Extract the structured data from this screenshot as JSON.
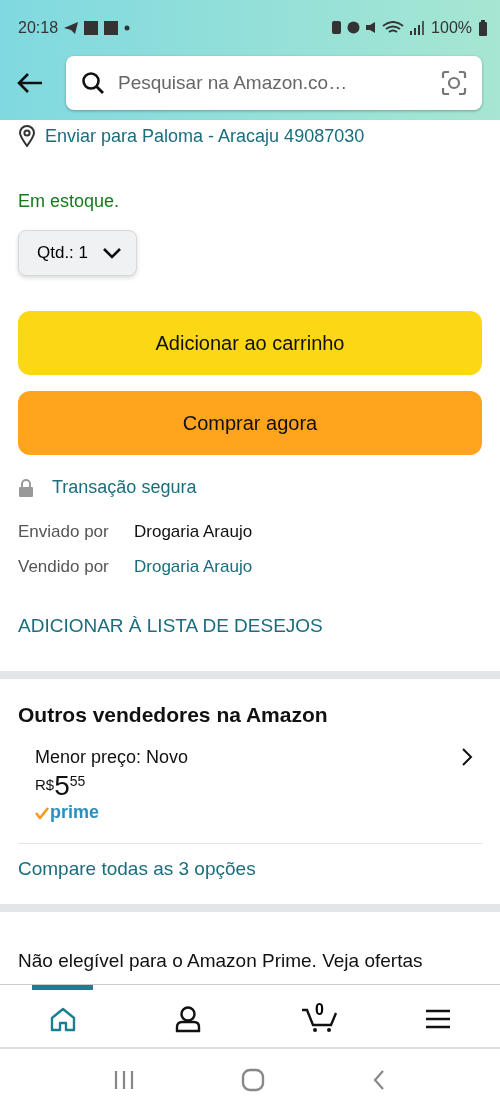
{
  "status_bar": {
    "time": "20:18",
    "battery": "100%"
  },
  "search": {
    "placeholder": "Pesquisar na Amazon.co…"
  },
  "delivery": {
    "text": "Enviar para Paloma - Aracaju 49087030"
  },
  "stock": "Em estoque.",
  "quantity": {
    "label": "Qtd.:",
    "value": "1"
  },
  "buttons": [
    {
      "label": "Adicionar ao carrinho",
      "kind": "cart"
    },
    {
      "label": "Comprar agora",
      "kind": "buy"
    }
  ],
  "secure": "Transação segura",
  "seller_info": [
    {
      "label": "Enviado por",
      "value": "Drogaria Araujo",
      "kind": "text"
    },
    {
      "label": "Vendido por",
      "value": "Drogaria Araujo",
      "kind": "link"
    }
  ],
  "wishlist": "ADICIONAR À LISTA DE DESEJOS",
  "other_sellers": {
    "title": "Outros vendedores na Amazon",
    "offer": "Menor preço: Novo",
    "currency": "R$",
    "price_whole": "5",
    "price_fraction": "55",
    "prime": "prime",
    "compare": "Compare todas as 3 opções"
  },
  "prime_note": "Não elegível para o Amazon Prime. Veja ofertas",
  "bottom_nav": [
    {
      "kind": "home",
      "selected": true
    },
    {
      "kind": "account",
      "selected": false
    },
    {
      "kind": "cart",
      "selected": false,
      "count": "0"
    },
    {
      "kind": "menu",
      "selected": false
    }
  ]
}
